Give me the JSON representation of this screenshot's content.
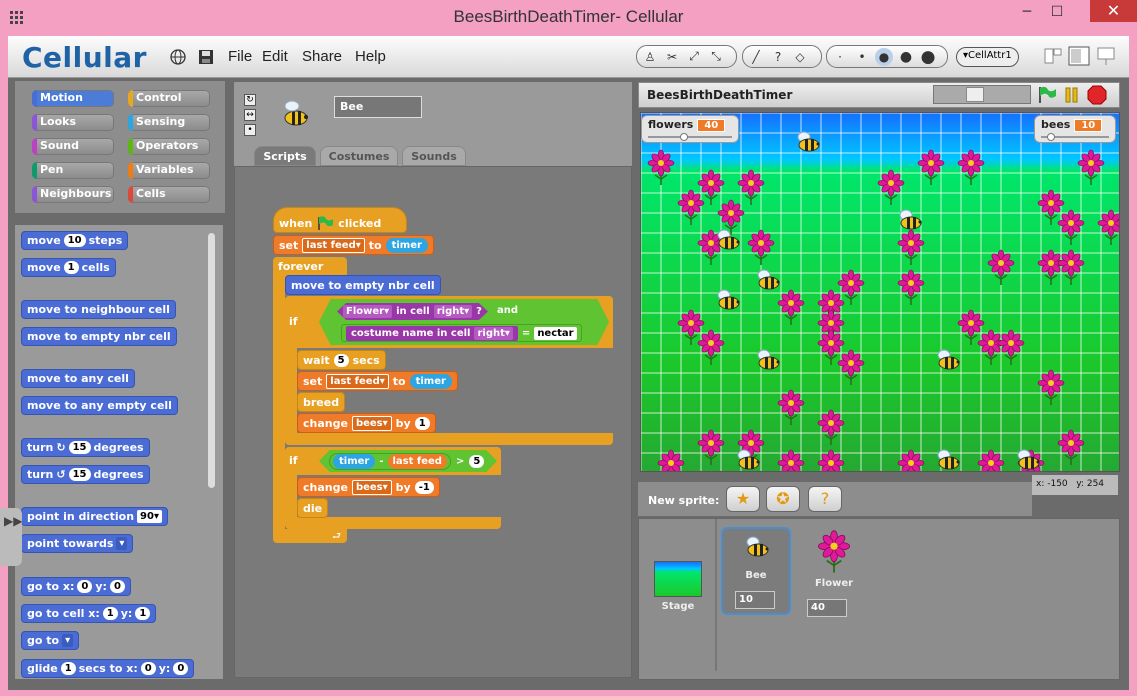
{
  "window": {
    "title": "BeesBirthDeathTimer- Cellular",
    "min_icon": "─",
    "max_icon": "☐",
    "close_icon": "✕"
  },
  "menu": {
    "logo": "Cellular",
    "items": [
      "File",
      "Edit",
      "Share",
      "Help"
    ],
    "cell_attr": "▾CellAttr1"
  },
  "categories": {
    "left": [
      "Motion",
      "Looks",
      "Sound",
      "Pen",
      "Neighbours"
    ],
    "right": [
      "Control",
      "Sensing",
      "Operators",
      "Variables",
      "Cells"
    ],
    "left_colors": [
      "#4a6cd4",
      "#8a55d7",
      "#bb42c3",
      "#0e9a6c",
      "#8a55d7"
    ],
    "right_colors": [
      "#e6a822",
      "#2ca5e2",
      "#5cb712",
      "#ee7d16",
      "#d94a3a"
    ]
  },
  "palette": {
    "move_steps": {
      "pre": "move",
      "val": "10",
      "post": "steps"
    },
    "move_cells": {
      "pre": "move",
      "val": "1",
      "post": "cells"
    },
    "move_neighbour": "move to neighbour cell",
    "move_empty_nbr": "move to empty nbr cell",
    "move_any": "move to any cell",
    "move_any_empty": "move to any empty cell",
    "turn_cw": {
      "pre": "turn",
      "icon": "↻",
      "val": "15",
      "post": "degrees"
    },
    "turn_ccw": {
      "pre": "turn",
      "icon": "↺",
      "val": "15",
      "post": "degrees"
    },
    "point_dir": {
      "pre": "point in direction",
      "val": "90▾"
    },
    "point_towards": {
      "pre": "point towards",
      "val": "▾"
    },
    "goto_xy": {
      "pre": "go to x:",
      "x": "0",
      "mid": "y:",
      "y": "0"
    },
    "goto_cell": {
      "pre": "go to cell x:",
      "x": "1",
      "mid": "y:",
      "y": "1"
    },
    "goto": {
      "pre": "go to",
      "val": "▾"
    },
    "glide": {
      "pre": "glide",
      "secs": "1",
      "mid": "secs to x:",
      "x": "0",
      "ylabel": "y:",
      "y": "0"
    }
  },
  "sprite": {
    "name": "Bee"
  },
  "tabs": [
    "Scripts",
    "Costumes",
    "Sounds"
  ],
  "script": {
    "when_clicked": {
      "pre": "when",
      "post": "clicked"
    },
    "set1": {
      "pre": "set",
      "var": "last feed▾",
      "mid": "to",
      "val": "timer"
    },
    "forever": "forever",
    "move_empty": "move to empty nbr cell",
    "if1": "if",
    "cond_flower": {
      "sprite": "Flower▾",
      "mid": "in cell",
      "dir": "right▾",
      "q": "?",
      "and": "and"
    },
    "cond_costume": {
      "pre": "costume name in cell",
      "dir": "right▾",
      "eq": "=",
      "val": "nectar"
    },
    "wait": {
      "pre": "wait",
      "val": "5",
      "post": "secs"
    },
    "set2": {
      "pre": "set",
      "var": "last feed▾",
      "mid": "to",
      "val": "timer"
    },
    "breed": "breed",
    "change1": {
      "pre": "change",
      "var": "bees▾",
      "mid": "by",
      "val": "1"
    },
    "if2": "if",
    "cond2": {
      "a": "timer",
      "op": "-",
      "b": "last feed",
      "gt": ">",
      "val": "5"
    },
    "change2": {
      "pre": "change",
      "var": "bees▾",
      "mid": "by",
      "val": "-1"
    },
    "die": "die"
  },
  "stage": {
    "title": "BeesBirthDeathTimer",
    "monitors": [
      {
        "label": "flowers",
        "value": "40"
      },
      {
        "label": "bees",
        "value": "10"
      }
    ],
    "coords": {
      "x_label": "x:",
      "x": "-150",
      "y_label": "y:",
      "y": "254"
    }
  },
  "new_sprite": {
    "label": "New sprite:"
  },
  "corral": {
    "stage_label": "Stage",
    "sprites": [
      {
        "name": "Bee",
        "count": "10"
      },
      {
        "name": "Flower",
        "count": "40"
      }
    ]
  },
  "colors": {
    "titlebar": "#f3a0c3",
    "logo": "#1f63a6",
    "stage_green_top": "#00c8ff",
    "stage_green": "#22dd33",
    "flower": "#e0199a"
  }
}
